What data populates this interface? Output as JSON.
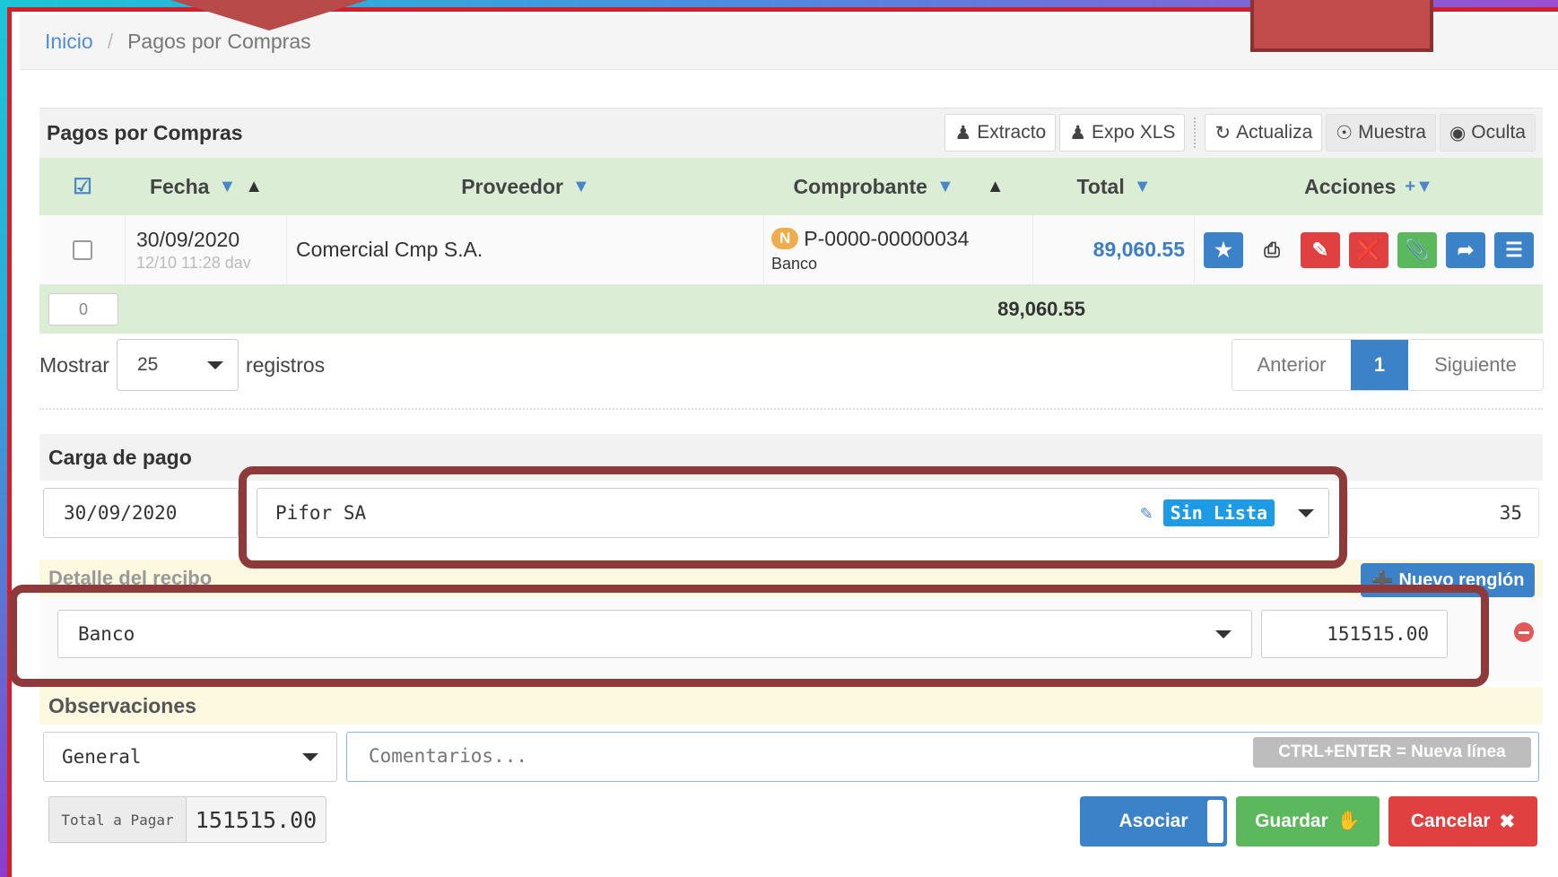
{
  "breadcrumb": {
    "home": "Inicio",
    "separator": "/",
    "current": "Pagos por Compras"
  },
  "panel": {
    "title": "Pagos por Compras",
    "tools": {
      "extracto": "Extracto",
      "expo_xls": "Expo XLS",
      "actualiza": "Actualiza",
      "muestra": "Muestra",
      "oculta": "Oculta"
    }
  },
  "table": {
    "headers": {
      "fecha": "Fecha",
      "proveedor": "Proveedor",
      "comprobante": "Comprobante",
      "total": "Total",
      "acciones": "Acciones"
    },
    "rows": [
      {
        "fecha": "30/09/2020",
        "fecha_sub": "12/10 11:28 dav",
        "proveedor": "Comercial Cmp S.A.",
        "badge": "N",
        "comprobante": "P-0000-00000034",
        "comprobante_sub": "Banco",
        "total": "89,060.55"
      }
    ],
    "footer": {
      "count": "0",
      "total": "89,060.55"
    }
  },
  "pagination": {
    "show_label": "Mostrar",
    "page_size": "25",
    "records_label": "registros",
    "prev": "Anterior",
    "current": "1",
    "next": "Siguiente"
  },
  "carga": {
    "title": "Carga de pago",
    "date": "30/09/2020",
    "proveedor": "Pifor SA",
    "sin_lista": "Sin Lista",
    "number": "35"
  },
  "detalle": {
    "title": "Detalle del recibo",
    "nuevo_renglon": "Nuevo renglón",
    "medio": "Banco",
    "importe": "151515.00"
  },
  "observaciones": {
    "title": "Observaciones",
    "tipo": "General",
    "placeholder": "Comentarios...",
    "hint": "CTRL+ENTER = Nueva línea"
  },
  "footer": {
    "total_label": "Total a Pagar",
    "total_value": "151515.00",
    "asociar": "Asociar",
    "guardar": "Guardar",
    "cancelar": "Cancelar"
  },
  "colors": {
    "primary": "#3b82c9",
    "success": "#5cb85c",
    "danger": "#e04040",
    "info": "#1e9be6",
    "warning": "#f0ad4e",
    "annotation": "#8e3a3a"
  }
}
